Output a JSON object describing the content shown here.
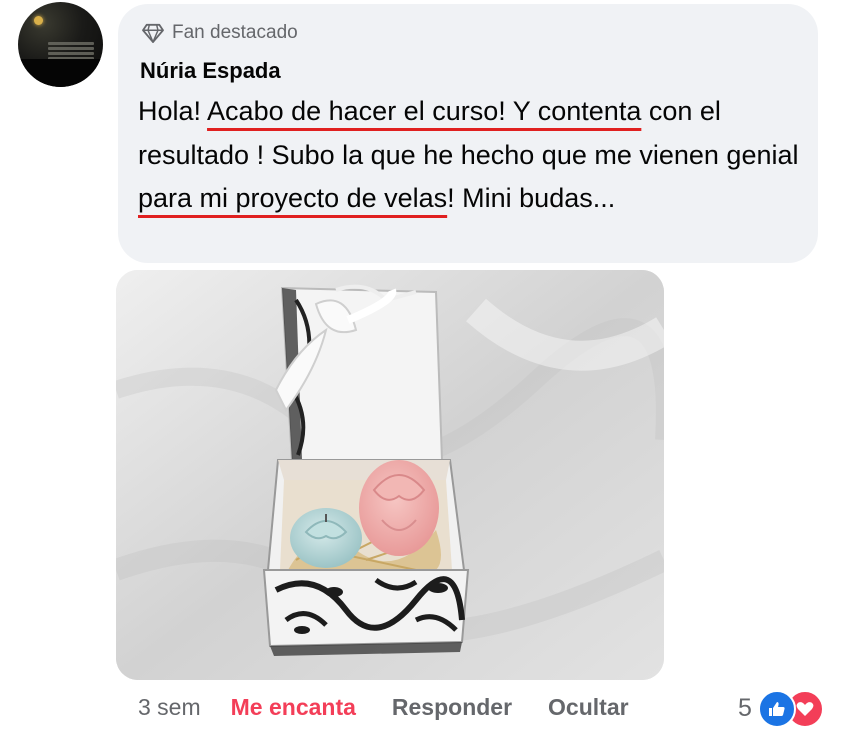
{
  "comment": {
    "badge_label": "Fan destacado",
    "author": "Núria Espada",
    "text_parts": [
      "Hola! ",
      "Acabo de hacer el curso! Y contenta",
      " con el resultado ! Subo la que he hecho que me vienen genial ",
      "para mi proyecto de velas",
      "! Mini budas..."
    ]
  },
  "actions": {
    "time": "3 sem",
    "love": "Me encanta",
    "reply": "Responder",
    "hide": "Ocultar"
  },
  "reactions": {
    "count": "5",
    "icons": [
      "like-icon",
      "heart-icon"
    ]
  },
  "colors": {
    "bubble": "#f0f2f5",
    "underline": "#e02020",
    "love": "#f33e58",
    "like": "#1b74e4",
    "secondary_text": "#65676b"
  }
}
